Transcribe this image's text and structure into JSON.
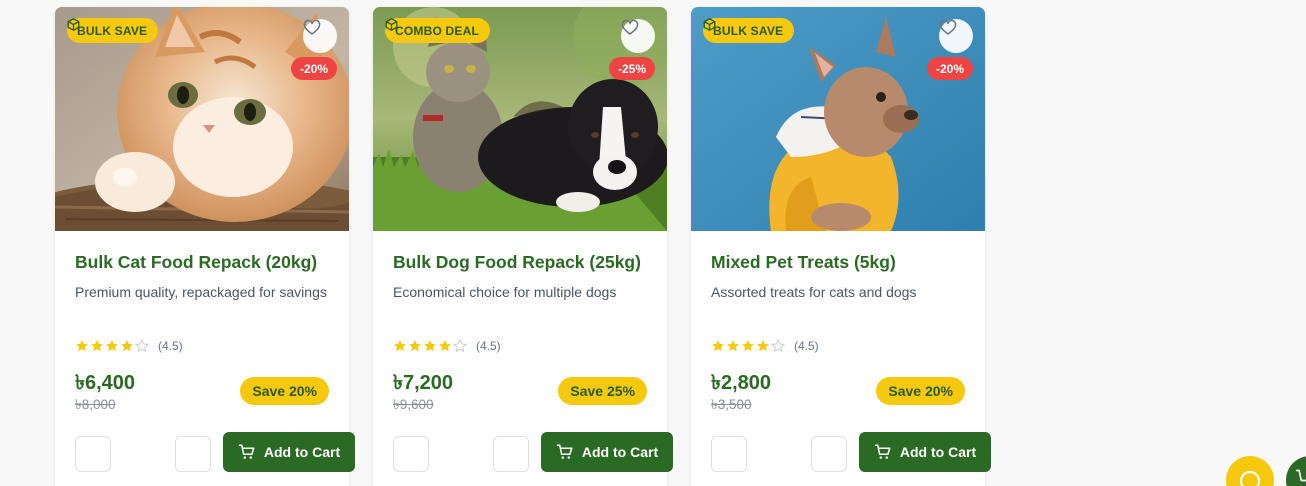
{
  "colors": {
    "brand_green": "#2b6a24",
    "accent_yellow": "#f6c90e",
    "discount_red": "#ef4444"
  },
  "products": [
    {
      "badge": "BULK SAVE",
      "badge_icon": "box-icon",
      "discount": "-20%",
      "image": "orange tabby kitten on wicker",
      "title": "Bulk Cat Food Repack (20kg)",
      "description": "Premium quality, repackaged for savings",
      "rating": 4.5,
      "rating_text": "(4.5)",
      "price": "৳6,400",
      "old_price": "৳8,000",
      "save": "Save 20%",
      "add_to_cart": "Add to Cart"
    },
    {
      "badge": "COMBO DEAL",
      "badge_icon": "box-icon",
      "discount": "-25%",
      "image": "cat and puppy lying on grass",
      "title": "Bulk Dog Food Repack (25kg)",
      "description": "Economical choice for multiple dogs",
      "rating": 4.5,
      "rating_text": "(4.5)",
      "price": "৳7,200",
      "old_price": "৳9,600",
      "save": "Save 25%",
      "add_to_cart": "Add to Cart"
    },
    {
      "badge": "BULK SAVE",
      "badge_icon": "box-icon",
      "discount": "-20%",
      "image": "french bulldog in yellow hoodie on blue background",
      "title": "Mixed Pet Treats (5kg)",
      "description": "Assorted treats for cats and dogs",
      "rating": 4.5,
      "rating_text": "(4.5)",
      "price": "৳2,800",
      "old_price": "৳3,500",
      "save": "Save 20%",
      "add_to_cart": "Add to Cart"
    }
  ],
  "floating": {
    "chat_icon": "chat-bubble-icon",
    "cart_icon": "cart-icon"
  }
}
